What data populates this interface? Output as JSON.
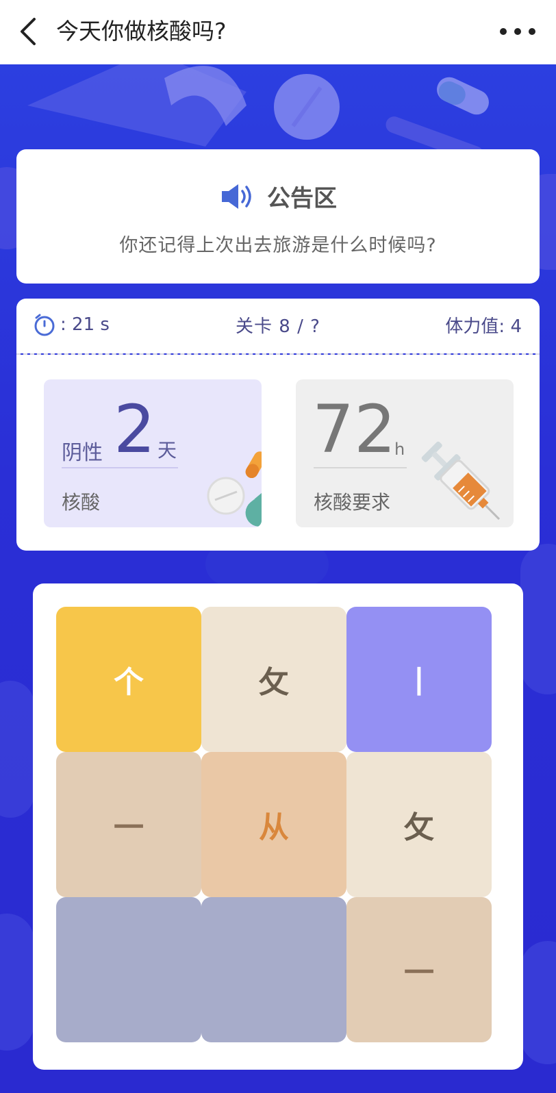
{
  "header": {
    "title": "今天你做核酸吗?"
  },
  "notice": {
    "title": "公告区",
    "text": "你还记得上次出去旅游是什么时候吗?"
  },
  "status": {
    "timer_text": ": 21 s",
    "timer_seconds": 21,
    "level_text": "关卡 8 / ?",
    "stamina_text": "体力值: 4",
    "stamina": 4
  },
  "stats": {
    "negative": {
      "prefix": "阴性",
      "value": "2",
      "unit": "天",
      "label": "核酸"
    },
    "requirement": {
      "value": "72",
      "unit": "h",
      "label": "核酸要求"
    }
  },
  "board": {
    "rows": 3,
    "cols": 3,
    "tiles": [
      {
        "char": "个",
        "color": "#f7c64a",
        "text_color": "#ffffff"
      },
      {
        "char": "攵",
        "color": "#efe4d3",
        "text_color": "#6b5f4f"
      },
      {
        "char": "丨",
        "color": "#9490f3",
        "text_color": "#ffffff"
      },
      {
        "char": "一",
        "color": "#e2ccb4",
        "text_color": "#8a7058"
      },
      {
        "char": "从",
        "color": "#eac8a6",
        "text_color": "#d9873c"
      },
      {
        "char": "攵",
        "color": "#efe4d3",
        "text_color": "#6b5f4f"
      },
      {
        "char": "",
        "color": "#a7acca",
        "text_color": "#ffffff"
      },
      {
        "char": "",
        "color": "#a7acca",
        "text_color": "#ffffff"
      },
      {
        "char": "一",
        "color": "#e2ccb4",
        "text_color": "#8a7058"
      }
    ]
  },
  "colors": {
    "background": "#2f36d8",
    "accent": "#4a4aa0",
    "negative_box": "#e8e6fb",
    "requirement_box": "#efefef"
  }
}
